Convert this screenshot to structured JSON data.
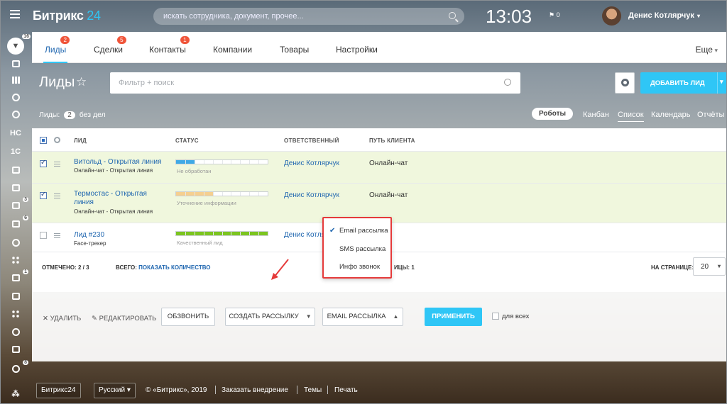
{
  "app": {
    "logo_text": "Битрикс",
    "logo_num": "24"
  },
  "search": {
    "placeholder": "искать сотрудника, документ, прочее..."
  },
  "clock": "13:03",
  "flag_count": "0",
  "user": {
    "name": "Денис Котлярчук"
  },
  "rail": {
    "badges": {
      "filter": "16",
      "tasks": "3",
      "chat": "6",
      "calendar": "1",
      "bottom": "8"
    },
    "hc_label": "НС",
    "onec_label": "1С"
  },
  "tabs": [
    {
      "label": "Лиды",
      "badge": "2"
    },
    {
      "label": "Сделки",
      "badge": "5"
    },
    {
      "label": "Контакты",
      "badge": "1"
    },
    {
      "label": "Компании",
      "badge": ""
    },
    {
      "label": "Товары",
      "badge": ""
    },
    {
      "label": "Настройки",
      "badge": ""
    }
  ],
  "more_label": "Еще",
  "page": {
    "title": "Лиды",
    "filter_placeholder": "Фильтр + поиск",
    "add_button": "ДОБАВИТЬ ЛИД"
  },
  "counter": {
    "label": "Лиды:",
    "count": "2",
    "suffix": "без дел"
  },
  "views": {
    "robots": "Роботы",
    "kanban": "Канбан",
    "list": "Список",
    "calendar": "Календарь",
    "reports": "Отчёты"
  },
  "columns": {
    "lead": "ЛИД",
    "status": "СТАТУС",
    "responsible": "ОТВЕТСТВЕННЫЙ",
    "path": "ПУТЬ КЛИЕНТА"
  },
  "rows": [
    {
      "name": "Витольд - Открытая линия",
      "source": "Онлайн-чат - Открытая линия",
      "status": "Не обработан",
      "progress": 0.2,
      "color": "#3fa9e6",
      "responsible": "Денис Котлярчук",
      "path": "Онлайн-чат",
      "checked": true
    },
    {
      "name": "Термостас - Открытая линия",
      "source": "Онлайн-чат - Открытая линия",
      "status": "Уточнение информации",
      "progress": 0.4,
      "color": "#f5cf8f",
      "responsible": "Денис Котлярчук",
      "path": "Онлайн-чат",
      "checked": true
    },
    {
      "name": "Лид #230",
      "source": "Face-трекер",
      "status": "Качественный лид",
      "progress": 1.0,
      "color": "#7cc520",
      "responsible": "Денис Котлярчук",
      "path": "",
      "checked": false
    }
  ],
  "grid_footer": {
    "marked_label": "ОТМЕЧЕНО:",
    "marked_value": "2 / 3",
    "total_label": "ВСЕГО:",
    "total_link": "ПОКАЗАТЬ КОЛИЧЕСТВО",
    "pages_partial": "ИЦЫ: 1",
    "per_page_label": "НА СТРАНИЦЕ:",
    "per_page": "20"
  },
  "actions": {
    "delete": "УДАЛИТЬ",
    "edit": "РЕДАКТИРОВАТЬ",
    "call": "ОБЗВОНИТЬ",
    "create_mailing": "СОЗДАТЬ РАССЫЛКУ",
    "email_mailing": "EMAIL РАССЫЛКА",
    "apply": "ПРИМЕНИТЬ",
    "for_all": "для всех"
  },
  "dropdown": {
    "items": [
      "Email рассылка",
      "SMS рассылка",
      "Инфо звонок"
    ],
    "selected": "Email рассылка"
  },
  "footer": {
    "logo": "Битрикс24",
    "lang": "Русский",
    "copyright": "© «Битрикс», 2019",
    "order": "Заказать внедрение",
    "themes": "Темы",
    "print": "Печать"
  }
}
